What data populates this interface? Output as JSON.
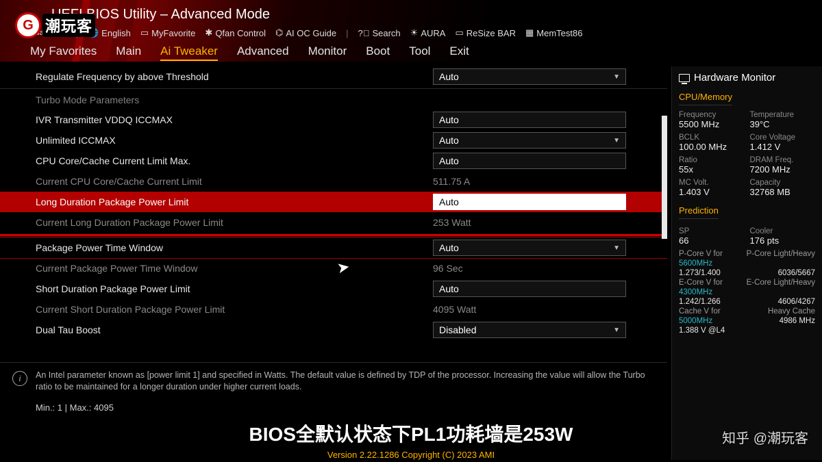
{
  "header": {
    "title": "UEFI BIOS Utility – Advanced Mode",
    "date": "Monday",
    "toolbar": {
      "language": "English",
      "favorite": "MyFavorite",
      "qfan": "Qfan Control",
      "aioc": "AI OC Guide",
      "search": "Search",
      "aura": "AURA",
      "resize": "ReSize BAR",
      "memtest": "MemTest86"
    }
  },
  "tabs": [
    "My Favorites",
    "Main",
    "Ai Tweaker",
    "Advanced",
    "Monitor",
    "Boot",
    "Tool",
    "Exit"
  ],
  "active_tab": "Ai Tweaker",
  "settings": [
    {
      "type": "dropdown",
      "label": "Regulate Frequency by above Threshold",
      "value": "Auto"
    },
    {
      "type": "section",
      "label": "Turbo Mode Parameters"
    },
    {
      "type": "text",
      "label": "IVR Transmitter VDDQ ICCMAX",
      "value": "Auto"
    },
    {
      "type": "dropdown",
      "label": "Unlimited ICCMAX",
      "value": "Auto"
    },
    {
      "type": "text",
      "label": "CPU Core/Cache Current Limit Max.",
      "value": "Auto"
    },
    {
      "type": "readonly",
      "label": "Current CPU Core/Cache Current Limit",
      "value": "511.75 A"
    },
    {
      "type": "text",
      "label": "Long Duration Package Power Limit",
      "value": "Auto",
      "selected": true
    },
    {
      "type": "readonly",
      "label": "Current Long Duration Package Power Limit",
      "value": "253 Watt"
    },
    {
      "type": "dropdown",
      "label": "Package Power Time Window",
      "value": "Auto",
      "boxed": true
    },
    {
      "type": "readonly",
      "label": "Current Package Power Time Window",
      "value": "96 Sec"
    },
    {
      "type": "text",
      "label": "Short Duration Package Power Limit",
      "value": "Auto"
    },
    {
      "type": "readonly",
      "label": "Current Short Duration Package Power Limit",
      "value": "4095 Watt"
    },
    {
      "type": "dropdown",
      "label": "Dual Tau Boost",
      "value": "Disabled"
    }
  ],
  "help_text": "An Intel parameter known as [power limit 1] and specified in Watts. The default value is defined by TDP of the processor. Increasing the value will allow the Turbo ratio to be maintained for a longer duration under higher current loads.",
  "minmax": "Min.: 1    |    Max.: 4095",
  "footer_version": "Version 2.22.1286 Copyright (C) 2023 AMI",
  "sidebar": {
    "title": "Hardware Monitor",
    "cpu_title": "CPU/Memory",
    "stats": {
      "freq_k": "Frequency",
      "freq_v": "5500 MHz",
      "temp_k": "Temperature",
      "temp_v": "39°C",
      "bclk_k": "BCLK",
      "bclk_v": "100.00 MHz",
      "cv_k": "Core Voltage",
      "cv_v": "1.412 V",
      "ratio_k": "Ratio",
      "ratio_v": "55x",
      "dram_k": "DRAM Freq.",
      "dram_v": "7200 MHz",
      "mcv_k": "MC Volt.",
      "mcv_v": "1.403 V",
      "cap_k": "Capacity",
      "cap_v": "32768 MB"
    },
    "pred_title": "Prediction",
    "pred": {
      "sp_k": "SP",
      "sp_v": "66",
      "cooler_k": "Cooler",
      "cooler_v": "176 pts",
      "pcorev_k": "P-Core V for",
      "pcore_f": "5600MHz",
      "pcore_lh_k": "P-Core Light/Heavy",
      "pcorev_v": "1.273/1.400",
      "pcore_lh_v": "6036/5667",
      "ecorev_k": "E-Core V for",
      "ecore_f": "4300MHz",
      "ecore_lh_k": "E-Core Light/Heavy",
      "ecorev_v": "1.242/1.266",
      "ecore_lh_v": "4606/4267",
      "cachev_k": "Cache V for",
      "cache_f": "5000MHz",
      "cache_lh_k": "Heavy Cache",
      "cachev_v": "1.388 V @L4",
      "cache_lh_v": "4986 MHz"
    }
  },
  "subtitle": "BIOS全默认状态下PL1功耗墙是253W",
  "watermark": "知乎 @潮玩客",
  "logo_text": "潮玩客"
}
